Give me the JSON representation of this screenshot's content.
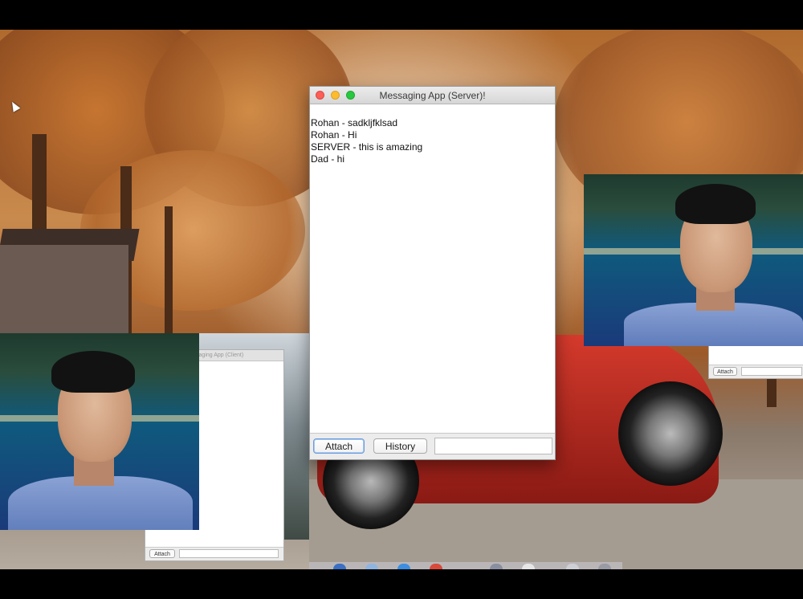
{
  "server_window": {
    "title": "Messaging App (Server)!",
    "messages": [
      "Rohan - sadkljfklsad",
      "Rohan - Hi",
      "SERVER - this is amazing",
      "Dad - hi"
    ],
    "attach_label": "Attach",
    "history_label": "History",
    "message_input_value": ""
  },
  "client_window": {
    "title": "Messaging App (Client)",
    "attach_label": "Attach",
    "message_input_value": ""
  },
  "second_client_window": {
    "attach_label": "Attach"
  },
  "colors": {
    "close": "#fc5f57",
    "minimize": "#fdbc2e",
    "zoom": "#28c840"
  }
}
